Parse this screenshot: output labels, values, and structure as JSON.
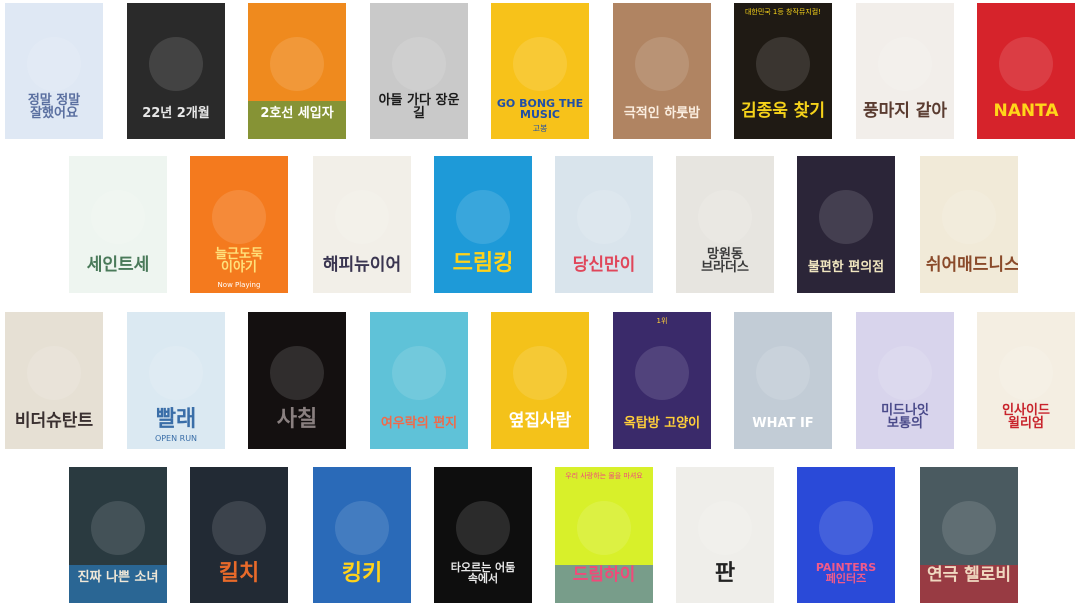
{
  "posters": [
    {
      "id": "p01",
      "title": "정말 정말 잘했어요",
      "bg": "#dfe8f4",
      "color": "#5a6fa0"
    },
    {
      "id": "p02",
      "title": "22년 2개월",
      "bg": "#2a2a2a",
      "color": "#e8e8e8"
    },
    {
      "id": "p03",
      "title": "2호선 세입자",
      "bg": "#ef8a1e",
      "color": "#ffffff",
      "accent": "#2f9a48"
    },
    {
      "id": "p04",
      "title": "아들 가다 장운 길",
      "bg": "#c9c9c9",
      "color": "#1a1a1a"
    },
    {
      "id": "p05",
      "title": "GO BONG THE MUSIC",
      "sub": "고봉",
      "bg": "#f7c21a",
      "color": "#1f4fa8"
    },
    {
      "id": "p06",
      "title": "극적인 하룻밤",
      "bg": "#b08462",
      "color": "#fbeee0"
    },
    {
      "id": "p07",
      "title": "김종욱 찾기",
      "top": "대한민국 1등 창작뮤지컬!",
      "bg": "#1f1a14",
      "color": "#f5d21a"
    },
    {
      "id": "p08",
      "title": "풍마지 같아",
      "bg": "#f2eeea",
      "color": "#5a3b30"
    },
    {
      "id": "p09",
      "title": "NANTA",
      "bg": "#d6232b",
      "color": "#ffd61a"
    },
    {
      "id": "p10",
      "title": "세인트세",
      "bg": "#eef5f0",
      "color": "#4a7a5a"
    },
    {
      "id": "p11",
      "title": "늘근도둑 이야기",
      "badge": "Now Playing",
      "bg": "#f47a1e",
      "color": "#ffe07a"
    },
    {
      "id": "p12",
      "title": "해피뉴이어",
      "bg": "#f2efe8",
      "color": "#3a3550"
    },
    {
      "id": "p13",
      "title": "드림킹",
      "bg": "#1e9ad8",
      "color": "#ffd21a"
    },
    {
      "id": "p14",
      "title": "당신만이",
      "bg": "#d9e4ec",
      "color": "#e0465a"
    },
    {
      "id": "p15",
      "title": "망원동 브라더스",
      "bg": "#e7e5e0",
      "color": "#3a3a3a"
    },
    {
      "id": "p16",
      "title": "불편한 편의점",
      "bg": "#2b2538",
      "color": "#f0e6c0"
    },
    {
      "id": "p17",
      "title": "쉬어매드니스",
      "bg": "#f1ead8",
      "color": "#8a4a2a"
    },
    {
      "id": "p18",
      "title": "비더슈탄트",
      "bg": "#e6e0d4",
      "color": "#3a3030"
    },
    {
      "id": "p19",
      "title": "빨래",
      "sub": "OPEN RUN",
      "bg": "#dbe9f2",
      "color": "#3a6ea8"
    },
    {
      "id": "p20",
      "title": "사칠",
      "bg": "#141010",
      "color": "#8a8080"
    },
    {
      "id": "p21",
      "title": "여우락의 편지",
      "bg": "#5fc2d8",
      "color": "#f06a4a"
    },
    {
      "id": "p22",
      "title": "옆집사람",
      "bg": "#f4c21a",
      "color": "#ffffff"
    },
    {
      "id": "p23",
      "title": "옥탑방 고양이",
      "top": "1위",
      "bg": "#3a2a6a",
      "color": "#ffcf3a"
    },
    {
      "id": "p24",
      "title": "WHAT IF",
      "bg": "#c2ccd6",
      "color": "#ffffff"
    },
    {
      "id": "p25",
      "title": "미드나잇 보통의",
      "bg": "#d8d4ec",
      "color": "#4a4a8a"
    },
    {
      "id": "p26",
      "title": "인사이드 윌리엄",
      "bg": "#f4eee2",
      "color": "#c8232b"
    },
    {
      "id": "p27",
      "title": "진짜 나쁜 소녀",
      "bg": "#2a3a40",
      "color": "#f0e8d8",
      "accent": "#2a8ad8"
    },
    {
      "id": "p28",
      "title": "킬치",
      "bg": "#222a34",
      "color": "#e86a2a"
    },
    {
      "id": "p29",
      "title": "킹키",
      "bg": "#2a6ab8",
      "color": "#ffd21a"
    },
    {
      "id": "p30",
      "title": "타오르는 어둠 속에서",
      "bg": "#0e0e0e",
      "color": "#e8e8e8"
    },
    {
      "id": "p31",
      "title": "드림하이",
      "top": "우리 사랑하는 물을 마셔요",
      "bg": "#d8f02a",
      "color": "#f04a7a",
      "accent": "#2a5ad8"
    },
    {
      "id": "p32",
      "title": "판",
      "bg": "#efeeea",
      "color": "#222222"
    },
    {
      "id": "p33",
      "title": "PAINTERS 페인터즈",
      "bg": "#2a4ad8",
      "color": "#f05a8a"
    },
    {
      "id": "p34",
      "title": "연극 헬로비",
      "bg": "#4a5a60",
      "color": "#f0d8c0",
      "accent": "#d8232b"
    }
  ]
}
